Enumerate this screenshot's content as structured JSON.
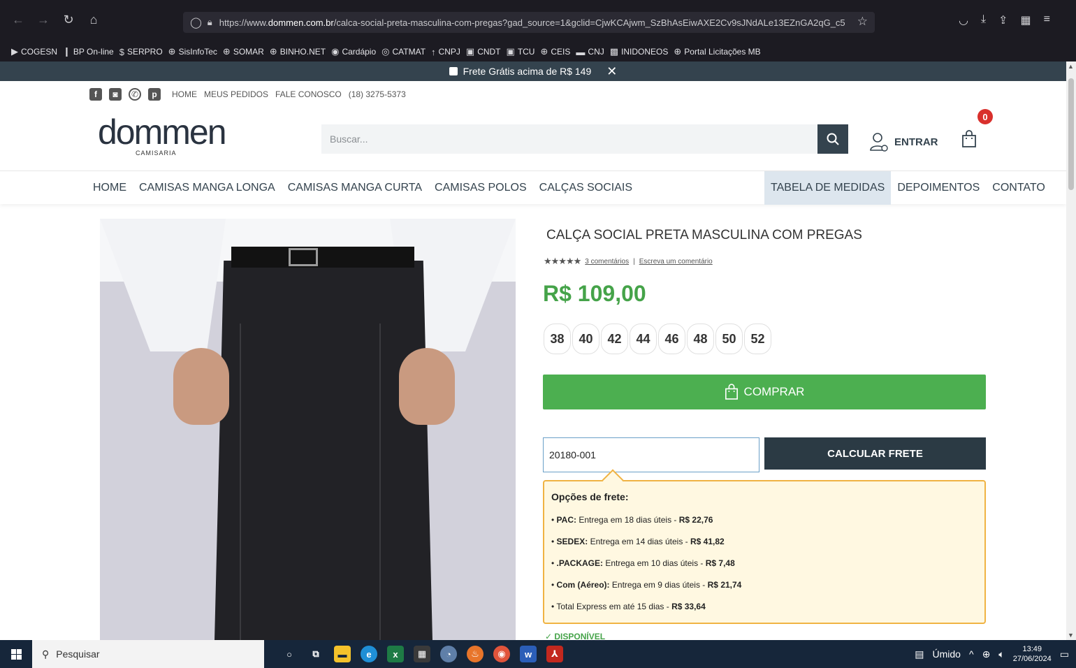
{
  "browser": {
    "url_prefix": "https://www.",
    "url_domain": "dommen.com.br",
    "url_path": "/calca-social-preta-masculina-com-pregas?gad_source=1&gclid=CjwKCAjwm_SzBhAsEiwAXE2Cv9sJNdALe13EZnGA2qG_c5"
  },
  "bookmarks": [
    "COGESN",
    "BP On-line",
    "SERPRO",
    "SisInfoTec",
    "SOMAR",
    "BINHO.NET",
    "Cardápio",
    "CATMAT",
    "CNPJ",
    "CNDT",
    "TCU",
    "CEIS",
    "CNJ",
    "INIDONEOS",
    "Portal Licitações MB"
  ],
  "promo": {
    "text": "Frete Grátis acima de R$ 149",
    "close": "✕"
  },
  "header": {
    "links": [
      "HOME",
      "MEUS PEDIDOS",
      "FALE CONOSCO",
      "(18) 3275-5373"
    ],
    "logo_word": "dommen",
    "logo_sub": "CAMISARIA",
    "search_placeholder": "Buscar...",
    "login_label": "ENTRAR",
    "cart_count": "0"
  },
  "menu": {
    "left": [
      "HOME",
      "CAMISAS MANGA LONGA",
      "CAMISAS MANGA CURTA",
      "CAMISAS POLOS",
      "CALÇAS SOCIAIS"
    ],
    "right": [
      "TABELA DE MEDIDAS",
      "DEPOIMENTOS",
      "CONTATO"
    ]
  },
  "product": {
    "title": "CALÇA SOCIAL PRETA MASCULINA COM PREGAS",
    "stars": "★★★★★",
    "comments_link": "3 comentários",
    "separator": "|",
    "write_comment": "Escreva um comentário",
    "price": "R$ 109,00",
    "sizes": [
      "38",
      "40",
      "42",
      "44",
      "46",
      "48",
      "50",
      "52"
    ],
    "buy_label": "COMPRAR",
    "cep_value": "20180-001",
    "calc_label": "CALCULAR FRETE",
    "availability": "✓ DISPONÍVEL"
  },
  "shipping": {
    "title": "Opções de frete:",
    "options": [
      {
        "name": "PAC:",
        "desc": " Entrega em 18 dias úteis - ",
        "price": "R$ 22,76"
      },
      {
        "name": "SEDEX:",
        "desc": " Entrega em 14 dias úteis - ",
        "price": "R$ 41,82"
      },
      {
        "name": ".PACKAGE:",
        "desc": " Entrega em 10 dias úteis - ",
        "price": "R$ 7,48"
      },
      {
        "name": "Com (Aéreo):",
        "desc": " Entrega em 9 dias úteis - ",
        "price": "R$ 21,74"
      },
      {
        "name": "",
        "desc": "Total Express em até 15 dias - ",
        "price": "R$ 33,64"
      }
    ]
  },
  "taskbar": {
    "search_placeholder": "Pesquisar",
    "weather": "Úmido",
    "time": "13:49",
    "date": "27/06/2024"
  },
  "colors": {
    "accent_green": "#4caf50",
    "price_green": "#45a349",
    "dark": "#34434e",
    "badge": "#d9302c",
    "ship_border": "#f0b343"
  }
}
